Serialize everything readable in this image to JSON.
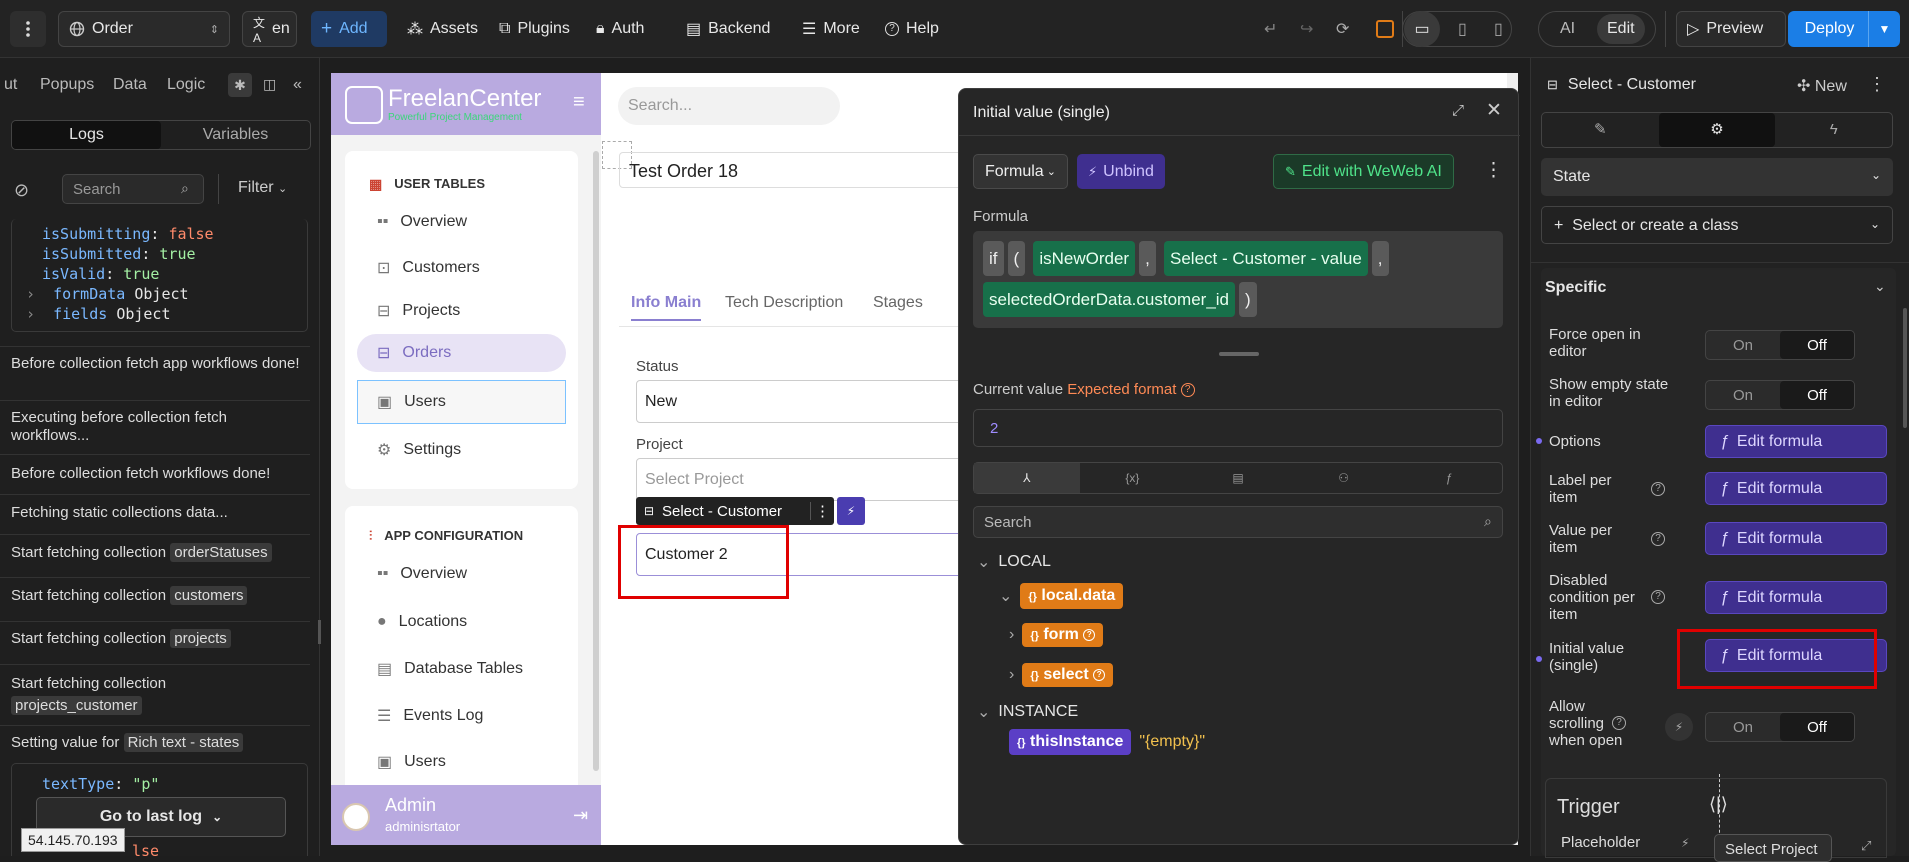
{
  "topbar": {
    "page_select": "Order",
    "lang": "en",
    "add": "Add",
    "assets": "Assets",
    "plugins": "Plugins",
    "auth": "Auth",
    "backend": "Backend",
    "more": "More",
    "help": "Help",
    "ai": "AI",
    "edit": "Edit",
    "preview": "Preview",
    "deploy": "Deploy"
  },
  "left": {
    "tabs": [
      "ut",
      "Popups",
      "Data",
      "Logic"
    ],
    "seg": [
      "Logs",
      "Variables"
    ],
    "search_placeholder": "Search",
    "filter": "Filter",
    "code1": [
      {
        "k": "isSubmitting",
        "v": "false"
      },
      {
        "k": "isSubmitted",
        "v": "true"
      },
      {
        "k": "isValid",
        "v": "true"
      }
    ],
    "code1_obj": [
      {
        "k": "formData",
        "v": "Object"
      },
      {
        "k": "fields",
        "v": "Object"
      }
    ],
    "logs": {
      "l1": "Before collection fetch app workflows done!",
      "l2": "Executing before collection fetch workflows...",
      "l3": "Before collection fetch workflows done!",
      "l4": "Fetching static collections data...",
      "l5": "Start fetching collection",
      "l5c": "orderStatuses",
      "l6": "Start fetching collection",
      "l6c": "customers",
      "l7": "Start fetching collection",
      "l7c": "projects",
      "l8": "Start fetching collection",
      "l8c": "projects_customer",
      "l9": "Setting value for",
      "l9c": "Rich text - states"
    },
    "code2_k": "textType",
    "code2_v": "\"p\"",
    "code2_tail": "lse",
    "goto": "Go to last log",
    "ip": "54.145.70.193"
  },
  "canvas": {
    "brand": "FreelanCenter",
    "brand_sub": "Powerful Project Management",
    "search_placeholder": "Search...",
    "order_title": "Test Order 18",
    "sec1": "USER TABLES",
    "nav1": [
      "Overview",
      "Customers",
      "Projects",
      "Orders",
      "Users",
      "Settings"
    ],
    "sec2": "APP CONFIGURATION",
    "nav2": [
      "Overview",
      "Locations",
      "Database Tables",
      "Events Log",
      "Users"
    ],
    "tabs": [
      "Info Main",
      "Tech Description",
      "Stages"
    ],
    "status_label": "Status",
    "status_value": "New",
    "project_label": "Project",
    "project_placeholder": "Select Project",
    "selected_tag": "Select - Customer",
    "customer_value": "Customer 2",
    "admin_name": "Admin",
    "admin_role": "adminisrtator"
  },
  "popup": {
    "title": "Initial value (single)",
    "formula_btn": "Formula",
    "unbind": "Unbind",
    "weweb_ai": "Edit with WeWeb AI",
    "formula_label": "Formula",
    "tokens": [
      "if",
      "(",
      "isNewOrder",
      ",",
      "Select - Customer - value",
      ",",
      "selectedOrderData.customer_id",
      ")"
    ],
    "current_label": "Current value",
    "expected": "Expected format",
    "current_value": "2",
    "search_placeholder": "Search",
    "local": "LOCAL",
    "local_data": "local.data",
    "form": "form",
    "select": "select",
    "instance": "INSTANCE",
    "this_instance": "thisInstance",
    "empty": "\"{empty}\""
  },
  "right": {
    "title": "Select - Customer",
    "new": "New",
    "state": "State",
    "class_select": "Select or create a class",
    "specific": "Specific",
    "force_open": "Force open in editor",
    "show_empty": "Show empty state in editor",
    "on": "On",
    "off": "Off",
    "options": "Options",
    "label_per_item": "Label per item",
    "value_per_item": "Value per item",
    "disabled_cond": "Disabled condition per item",
    "initial_value": "Initial value (single)",
    "allow_scroll": "Allow scrolling when open",
    "edit_formula": "Edit formula",
    "trigger": "Trigger",
    "placeholder": "Placeholder",
    "select_project": "Select Project"
  },
  "colors": {
    "accent": "#1b7ee6",
    "purple": "#3f2f8f",
    "green": "#17704a",
    "orange": "#e07b17",
    "highlight_red": "#e00000",
    "sidebar_purple": "#b3a3e0"
  }
}
